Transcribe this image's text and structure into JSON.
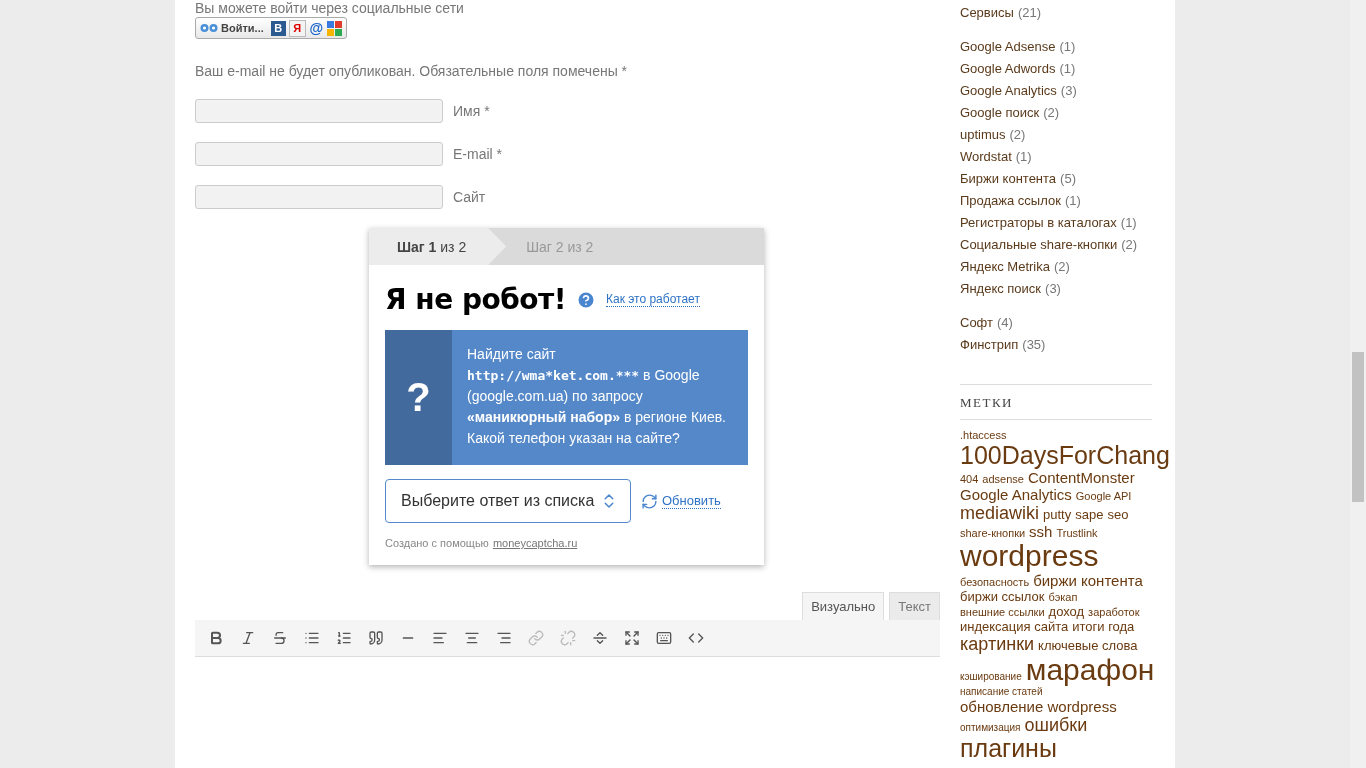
{
  "comment_form": {
    "social_intro": "Вы можете войти через социальные сети",
    "social_login": {
      "label": "Войти...",
      "services": [
        {
          "kind": "vk",
          "text": "В"
        },
        {
          "kind": "yandex",
          "text": "Я"
        },
        {
          "kind": "mail",
          "text": "@"
        },
        {
          "kind": "google"
        }
      ]
    },
    "notice": "Ваш e-mail не будет опубликован. Обязательные поля помечены *",
    "fields": [
      {
        "label": "Имя *"
      },
      {
        "label": "E-mail *"
      },
      {
        "label": "Сайт"
      }
    ]
  },
  "captcha": {
    "steps": [
      {
        "label": "**Шаг 1** из 2",
        "selected": true
      },
      {
        "label": "Шаг 2 из 2",
        "selected": false
      }
    ],
    "title": "Я не робот!",
    "help_link": "Как это работает",
    "question_mark": "?",
    "task": [
      {
        "text": "Найдите сайт ",
        "bold": false
      },
      {
        "text": "http://wma*ket.com.***",
        "bold": true
      },
      {
        "text": " в Google (google.com.ua) по запросу ",
        "bold": false
      },
      {
        "text": "«маникюрный набор»",
        "bold": true
      },
      {
        "text": " в регионе Киев. Какой телефон указан на сайте?",
        "bold": false
      }
    ],
    "select": {
      "placeholder": "Выберите ответ из списка"
    },
    "refresh": "Обновить",
    "footer": "Создано с помощью",
    "footer_link": "moneycaptcha.ru"
  },
  "editor": {
    "tabs": [
      {
        "label": "Визуально",
        "selected": true
      },
      {
        "label": "Текст",
        "selected": false
      }
    ],
    "toolbar": [
      {
        "kind": "bold",
        "disabled": false
      },
      {
        "kind": "italic",
        "disabled": false
      },
      {
        "kind": "strike",
        "disabled": false
      },
      {
        "kind": "bullets",
        "disabled": false
      },
      {
        "kind": "numbers",
        "disabled": false
      },
      {
        "kind": "quote",
        "disabled": false
      },
      {
        "kind": "hr",
        "disabled": false
      },
      {
        "kind": "align-left",
        "disabled": false
      },
      {
        "kind": "align-center",
        "disabled": false
      },
      {
        "kind": "align-right",
        "disabled": false
      },
      {
        "kind": "link",
        "disabled": true
      },
      {
        "kind": "unlink",
        "disabled": true
      },
      {
        "kind": "more",
        "disabled": false
      },
      {
        "kind": "fullscreen",
        "disabled": false
      },
      {
        "kind": "kitchen",
        "disabled": false
      },
      {
        "kind": "code",
        "disabled": false
      }
    ]
  },
  "sidebar": {
    "category_groups": [
      [
        {
          "name": "Сервисы",
          "count": "(21)"
        }
      ],
      [
        {
          "name": "Google Adsense",
          "count": "(1)"
        },
        {
          "name": "Google Adwords",
          "count": "(1)"
        },
        {
          "name": "Google Analytics",
          "count": "(3)"
        },
        {
          "name": "Google поиск",
          "count": "(2)"
        },
        {
          "name": "uptimus",
          "count": "(2)"
        },
        {
          "name": "Wordstat",
          "count": "(1)"
        },
        {
          "name": "Биржи контента",
          "count": "(5)"
        },
        {
          "name": "Продажа ссылок",
          "count": "(1)"
        },
        {
          "name": "Регистраторы в каталогах",
          "count": "(1)"
        },
        {
          "name": "Социальные share-кнопки",
          "count": "(2)"
        },
        {
          "name": "Яндекс Metrika",
          "count": "(2)"
        },
        {
          "name": "Яндекс поиск",
          "count": "(3)"
        }
      ],
      [
        {
          "name": "Софт",
          "count": "(4)"
        },
        {
          "name": "Финстрип",
          "count": "(35)"
        }
      ]
    ],
    "tags_title": "МЕТКИ",
    "tags": [
      {
        "text": ".htaccess",
        "kind": "xs"
      },
      {
        "text": "100DaysForChang",
        "kind": "xl"
      },
      {
        "text": "404",
        "kind": "xs"
      },
      {
        "text": "adsense",
        "kind": "xs"
      },
      {
        "text": "ContentMonster",
        "kind": "m"
      },
      {
        "text": "Google Analytics",
        "kind": "m"
      },
      {
        "text": "Google API",
        "kind": "xs"
      },
      {
        "text": "mediawiki",
        "kind": "l"
      },
      {
        "text": "putty",
        "kind": "s"
      },
      {
        "text": "sape",
        "kind": "s"
      },
      {
        "text": "seo",
        "kind": "s"
      },
      {
        "text": "share-кнопки",
        "kind": "xs"
      },
      {
        "text": "ssh",
        "kind": "m"
      },
      {
        "text": "Trustlink",
        "kind": "xs"
      },
      {
        "text": "wordpress",
        "kind": "xxl"
      },
      {
        "text": "безопасность",
        "kind": "xs"
      },
      {
        "text": "биржи контента",
        "kind": "m"
      },
      {
        "text": "биржи ссылок",
        "kind": "s"
      },
      {
        "text": "бэкап",
        "kind": "xs"
      },
      {
        "text": "внешние ссылки",
        "kind": "xs"
      },
      {
        "text": "доход",
        "kind": "s"
      },
      {
        "text": "заработок",
        "kind": "xs"
      },
      {
        "text": "индексация сайта",
        "kind": "s"
      },
      {
        "text": "итоги года",
        "kind": "s"
      },
      {
        "text": "картинки",
        "kind": "l"
      },
      {
        "text": "ключевые слова",
        "kind": "s"
      },
      {
        "text": "кэширование",
        "kind": "xxs"
      },
      {
        "text": "марафон",
        "kind": "xxl"
      },
      {
        "text": "написание статей",
        "kind": "xxs"
      },
      {
        "text": "обновление wordpress",
        "kind": "m"
      },
      {
        "text": "оптимизация",
        "kind": "xxs"
      },
      {
        "text": "ошибки",
        "kind": "l"
      },
      {
        "text": "плагины",
        "kind": "xl"
      }
    ]
  }
}
